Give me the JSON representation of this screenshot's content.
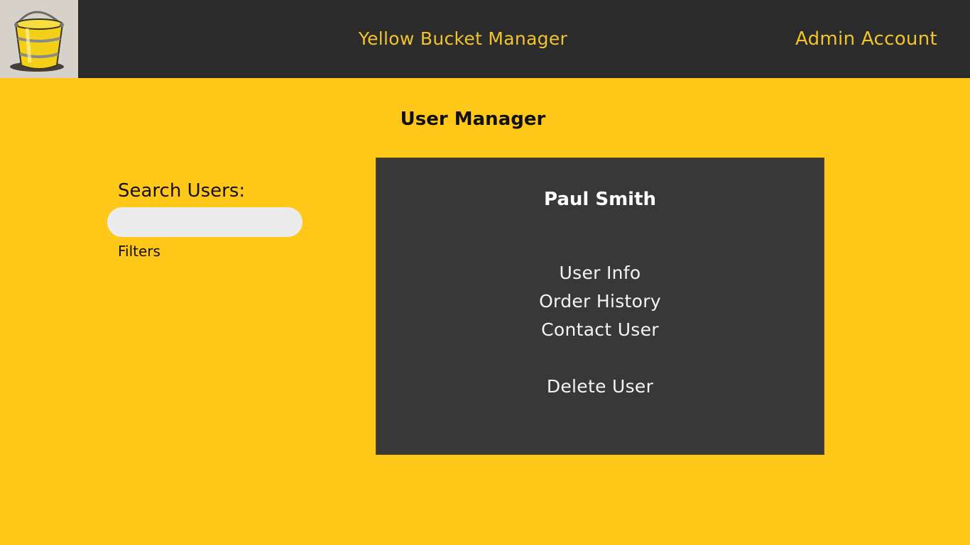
{
  "header": {
    "logo_icon": "yellow-bucket-icon",
    "app_title": "Yellow Bucket Manager",
    "account_label": "Admin Account"
  },
  "main": {
    "page_title": "User Manager",
    "search": {
      "label": "Search Users:",
      "value": "",
      "placeholder": "",
      "filters_label": "Filters"
    },
    "user_panel": {
      "name": "Paul Smith",
      "actions": {
        "user_info": "User Info",
        "order_history": "Order History",
        "contact_user": "Contact User",
        "delete_user": "Delete User"
      }
    }
  },
  "colors": {
    "background": "#ffc718",
    "header": "#2b2b2b",
    "accent_text": "#f2c42c",
    "panel": "#383838"
  }
}
